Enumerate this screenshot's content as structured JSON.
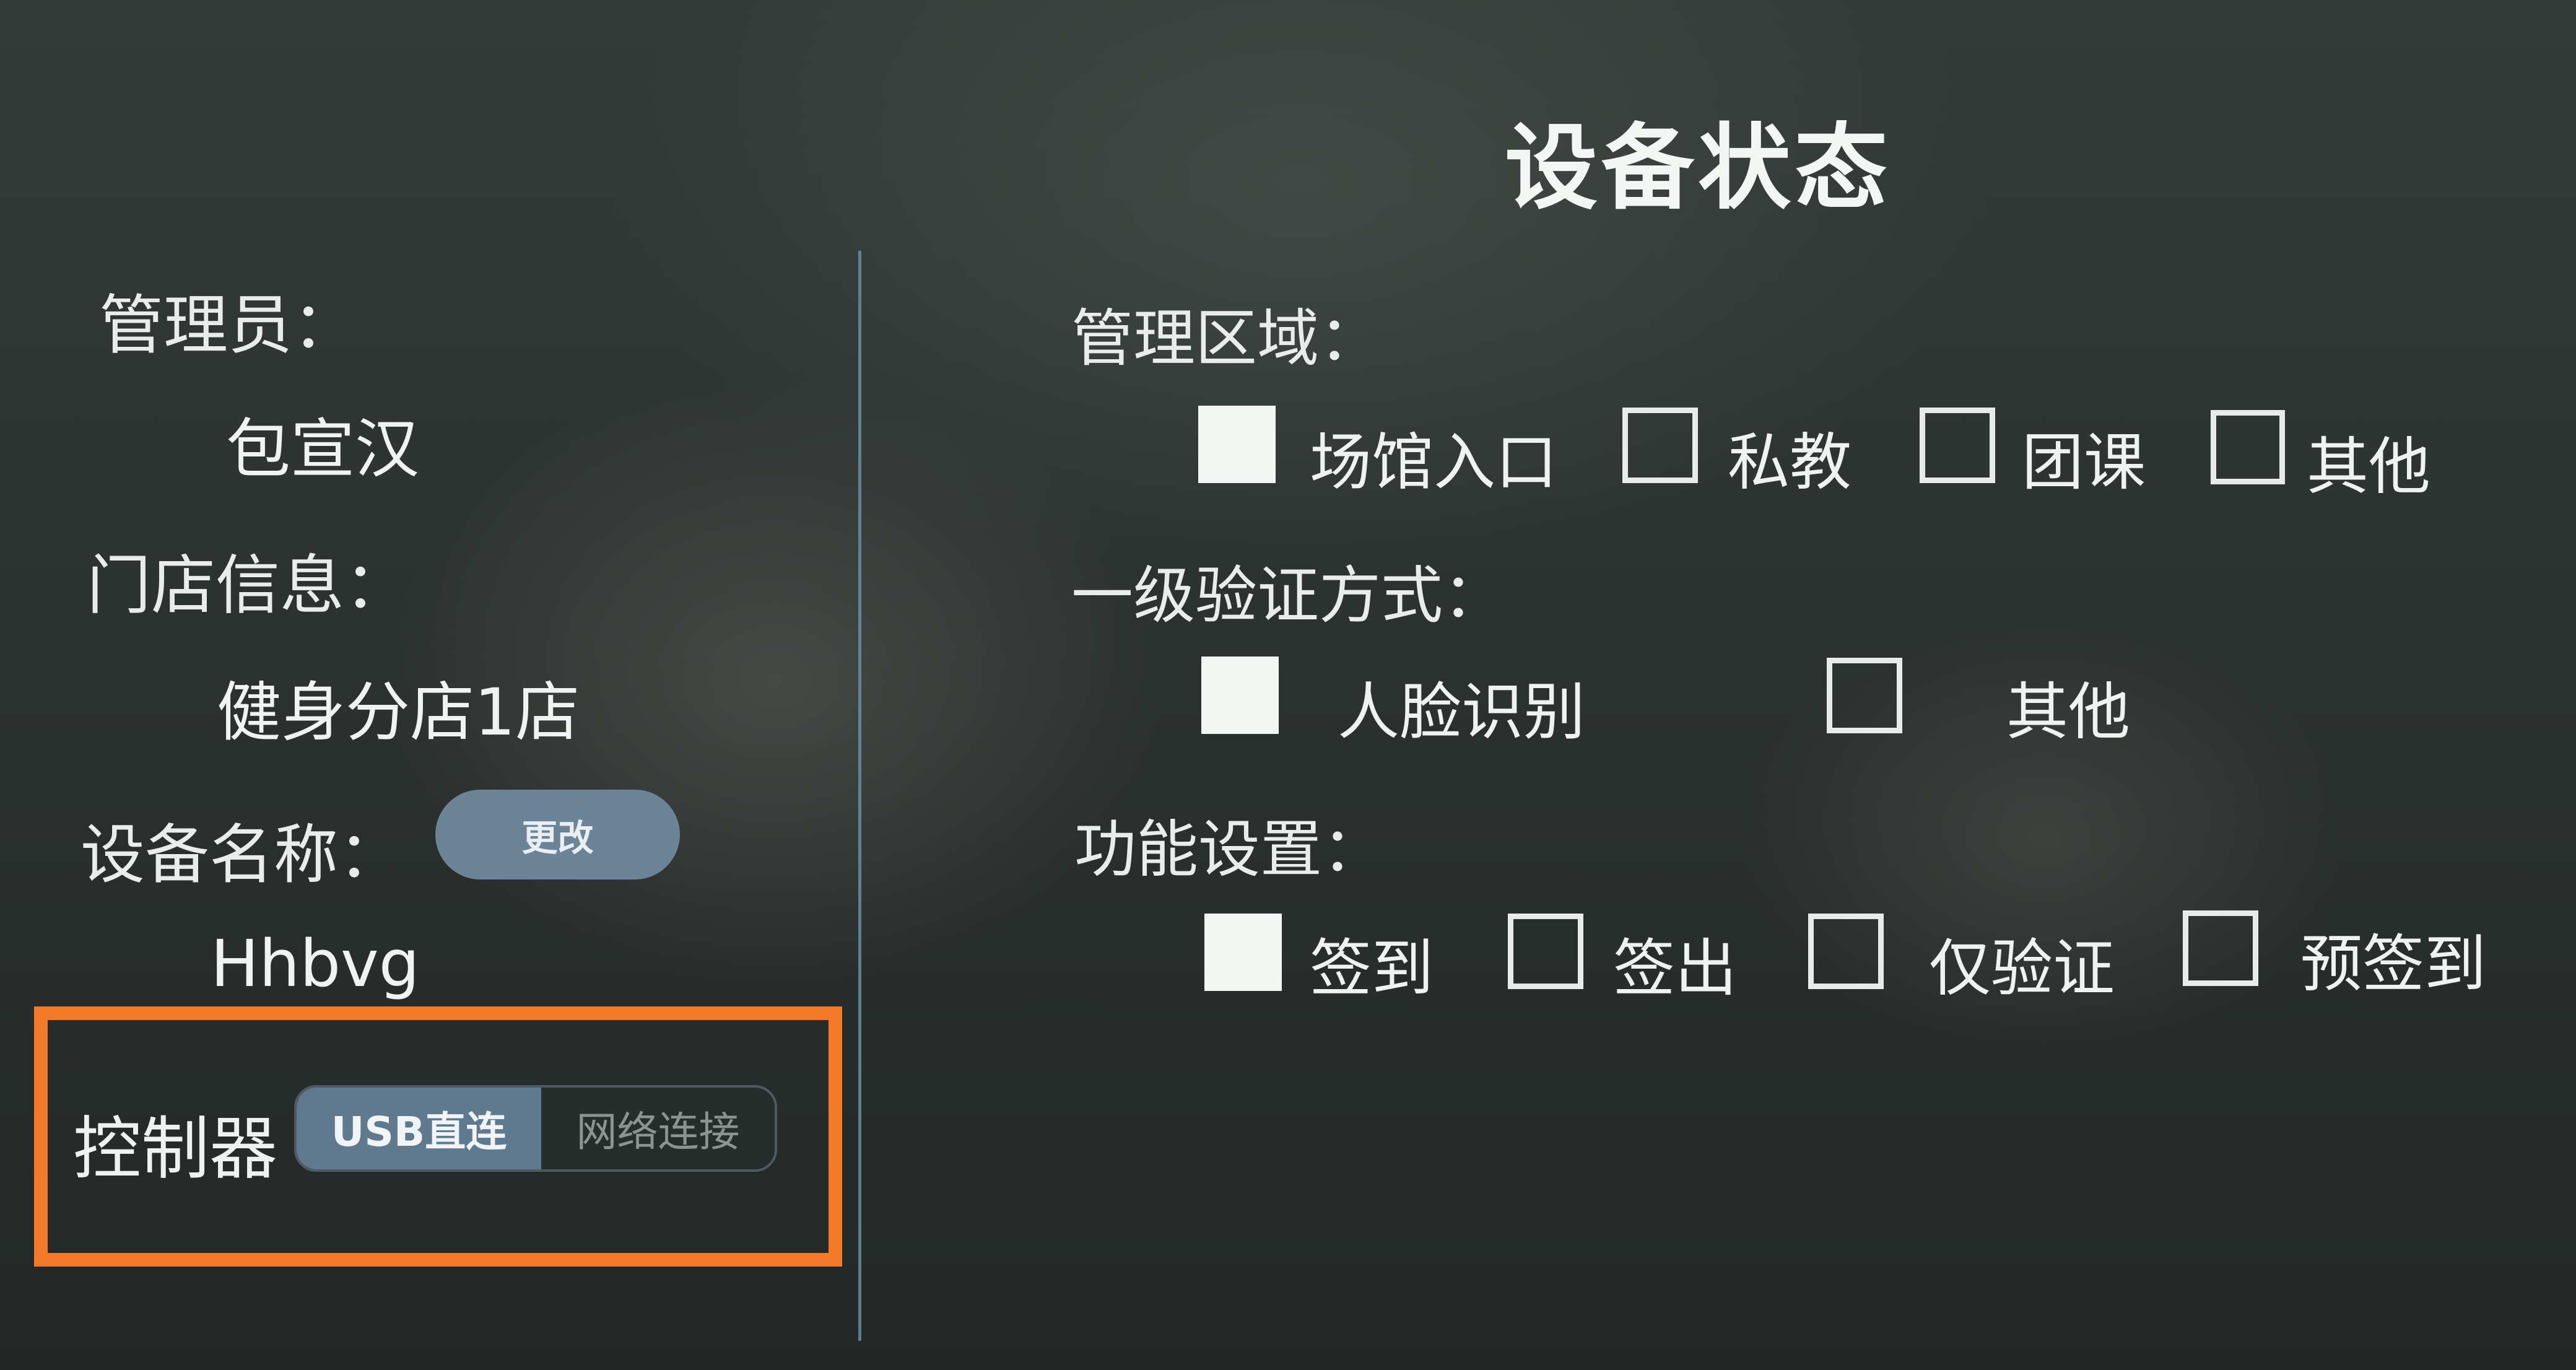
{
  "title": "设备状态",
  "left_panel": {
    "admin_label": "管理员：",
    "admin_value": "包宣汉",
    "store_label": "门店信息：",
    "store_value": "健身分店1店",
    "device_name_label": "设备名称：",
    "rename_button": "更改",
    "device_name_value": "Hhbvg",
    "controller_label": "控制器",
    "controller_options": [
      "USB直连",
      "网络连接"
    ],
    "controller_selected": "USB直连"
  },
  "sections": [
    {
      "label": "管理区域：",
      "options": [
        {
          "label": "场馆入口",
          "checked": true
        },
        {
          "label": "私教",
          "checked": false
        },
        {
          "label": "团课",
          "checked": false
        },
        {
          "label": "其他",
          "checked": false
        }
      ]
    },
    {
      "label": "一级验证方式：",
      "options": [
        {
          "label": "人脸识别",
          "checked": true
        },
        {
          "label": "其他",
          "checked": false
        }
      ]
    },
    {
      "label": "功能设置：",
      "options": [
        {
          "label": "签到",
          "checked": true
        },
        {
          "label": "签出",
          "checked": false
        },
        {
          "label": "仅验证",
          "checked": false
        },
        {
          "label": "预签到",
          "checked": false
        }
      ]
    }
  ],
  "colors": {
    "highlight_box": "#f47a2a",
    "segment_selected": "#5f7a8e",
    "rename_button": "#6b8498"
  }
}
